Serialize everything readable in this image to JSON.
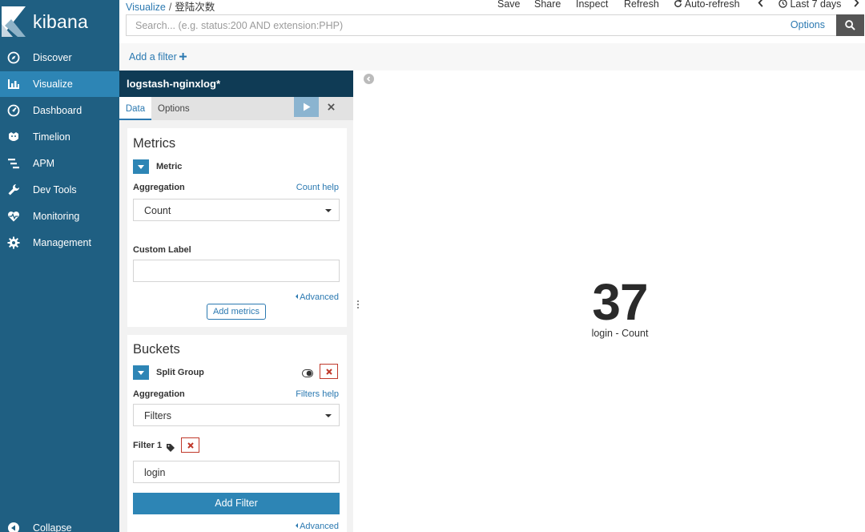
{
  "app": {
    "name": "kibana"
  },
  "nav": {
    "items": [
      {
        "label": "Discover",
        "icon": "compass-icon"
      },
      {
        "label": "Visualize",
        "icon": "bar-chart-icon"
      },
      {
        "label": "Dashboard",
        "icon": "dashboard-icon"
      },
      {
        "label": "Timelion",
        "icon": "timelion-icon"
      },
      {
        "label": "APM",
        "icon": "apm-icon"
      },
      {
        "label": "Dev Tools",
        "icon": "wrench-icon"
      },
      {
        "label": "Monitoring",
        "icon": "heartbeat-icon"
      },
      {
        "label": "Management",
        "icon": "gear-icon"
      }
    ],
    "active": "Visualize",
    "collapse_label": "Collapse"
  },
  "breadcrumb": {
    "root": "Visualize",
    "separator": "/",
    "current": "登陆次数"
  },
  "toolbar": {
    "save": "Save",
    "share": "Share",
    "inspect": "Inspect",
    "refresh": "Refresh",
    "auto_refresh": "Auto-refresh",
    "time_range": "Last 7 days"
  },
  "search": {
    "placeholder": "Search... (e.g. status:200 AND extension:PHP)",
    "value": "",
    "options_label": "Options"
  },
  "filter_bar": {
    "add_filter": "Add a filter"
  },
  "editor": {
    "index_pattern": "logstash-nginxlog*",
    "tabs": [
      "Data",
      "Options"
    ],
    "active_tab": "Data",
    "metrics": {
      "title": "Metrics",
      "agg_name": "Metric",
      "aggregation_label": "Aggregation",
      "help": "Count help",
      "aggregation": "Count",
      "custom_label_label": "Custom Label",
      "custom_label": "",
      "advanced": "Advanced",
      "add_metrics": "Add metrics"
    },
    "buckets": {
      "title": "Buckets",
      "agg_name": "Split Group",
      "aggregation_label": "Aggregation",
      "help": "Filters help",
      "aggregation": "Filters",
      "filter_label": "Filter 1",
      "filter_value": "login",
      "add_filter": "Add Filter",
      "advanced": "Advanced"
    }
  },
  "visualization": {
    "value": "37",
    "label": "login - Count"
  },
  "colors": {
    "sidebar": "#1f5f82",
    "sidebar_active": "#2d85b5",
    "editor_header": "#0f3b55",
    "link": "#2b79b1",
    "primary_button": "#2d85b5",
    "danger": "#c0392b"
  }
}
